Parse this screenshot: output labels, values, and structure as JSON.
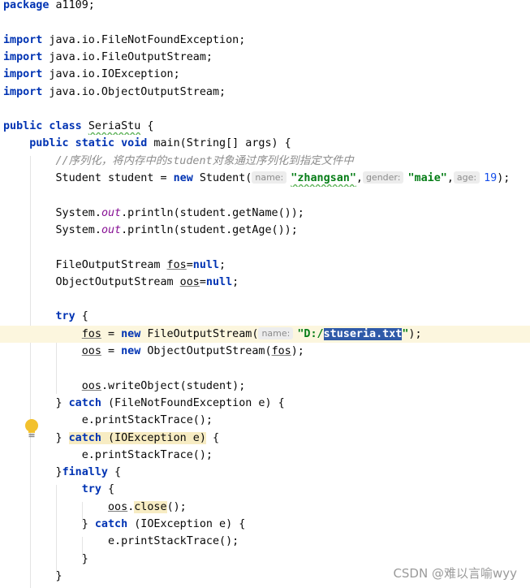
{
  "editor": {
    "language": "Java",
    "lines": [
      {
        "i": 0,
        "current": false,
        "segs": [
          {
            "c": "kw",
            "t": "package"
          },
          {
            "c": "",
            "t": " a1109;"
          }
        ]
      },
      {
        "i": 2,
        "current": false,
        "segs": [
          {
            "c": "kw",
            "t": "import"
          },
          {
            "c": "",
            "t": " java.io.FileNotFoundException;"
          }
        ]
      },
      {
        "i": 3,
        "current": false,
        "segs": [
          {
            "c": "kw",
            "t": "import"
          },
          {
            "c": "",
            "t": " java.io.FileOutputStream;"
          }
        ]
      },
      {
        "i": 4,
        "current": false,
        "segs": [
          {
            "c": "kw",
            "t": "import"
          },
          {
            "c": "",
            "t": " java.io.IOException;"
          }
        ]
      },
      {
        "i": 5,
        "current": false,
        "segs": [
          {
            "c": "kw",
            "t": "import"
          },
          {
            "c": "",
            "t": " java.io.ObjectOutputStream;"
          }
        ]
      },
      {
        "i": 7,
        "current": false,
        "segs": [
          {
            "c": "kw",
            "t": "public class"
          },
          {
            "c": "",
            "t": " "
          },
          {
            "c": "wavy",
            "t": "SeriaStu"
          },
          {
            "c": "",
            "t": " {"
          }
        ]
      },
      {
        "i": 8,
        "current": false,
        "segs": [
          {
            "c": "",
            "t": "    "
          },
          {
            "c": "kw",
            "t": "public static void"
          },
          {
            "c": "",
            "t": " main(String[] args) {"
          }
        ]
      },
      {
        "i": 9,
        "current": false,
        "segs": [
          {
            "c": "",
            "t": "        "
          },
          {
            "c": "cmt",
            "t": "//序列化，将内存中的student对象通过序列化到指定文件中"
          }
        ]
      },
      {
        "i": 10,
        "current": false,
        "segs": [
          {
            "c": "",
            "t": "        Student student = "
          },
          {
            "c": "kw",
            "t": "new"
          },
          {
            "c": "",
            "t": " Student("
          },
          {
            "c": "hint",
            "t": "name:"
          },
          {
            "c": "str wavy",
            "t": "\"zhangsan\""
          },
          {
            "c": "",
            "t": ","
          },
          {
            "c": "hint",
            "t": "gender:"
          },
          {
            "c": "str",
            "t": "\"maie\""
          },
          {
            "c": "",
            "t": ","
          },
          {
            "c": "hint",
            "t": "age:"
          },
          {
            "c": "num",
            "t": "19"
          },
          {
            "c": "",
            "t": ");"
          }
        ]
      },
      {
        "i": 12,
        "current": false,
        "segs": [
          {
            "c": "",
            "t": "        System."
          },
          {
            "c": "fld",
            "t": "out"
          },
          {
            "c": "",
            "t": ".println(student.getName());"
          }
        ]
      },
      {
        "i": 13,
        "current": false,
        "segs": [
          {
            "c": "",
            "t": "        System."
          },
          {
            "c": "fld",
            "t": "out"
          },
          {
            "c": "",
            "t": ".println(student.getAge());"
          }
        ]
      },
      {
        "i": 15,
        "current": false,
        "segs": [
          {
            "c": "",
            "t": "        FileOutputStream "
          },
          {
            "c": "var",
            "t": "fos"
          },
          {
            "c": "",
            "t": "="
          },
          {
            "c": "kw",
            "t": "null"
          },
          {
            "c": "",
            "t": ";"
          }
        ]
      },
      {
        "i": 16,
        "current": false,
        "segs": [
          {
            "c": "",
            "t": "        ObjectOutputStream "
          },
          {
            "c": "var",
            "t": "oos"
          },
          {
            "c": "",
            "t": "="
          },
          {
            "c": "kw",
            "t": "null"
          },
          {
            "c": "",
            "t": ";"
          }
        ]
      },
      {
        "i": 18,
        "current": false,
        "segs": [
          {
            "c": "",
            "t": "        "
          },
          {
            "c": "kw",
            "t": "try"
          },
          {
            "c": "",
            "t": " {"
          }
        ]
      },
      {
        "i": 19,
        "current": true,
        "segs": [
          {
            "c": "",
            "t": "            "
          },
          {
            "c": "var",
            "t": "fos"
          },
          {
            "c": "",
            "t": " = "
          },
          {
            "c": "kw",
            "t": "new"
          },
          {
            "c": "",
            "t": " FileOutputStream("
          },
          {
            "c": "hint",
            "t": "name:"
          },
          {
            "c": "str",
            "t": "\"D:/"
          },
          {
            "c": "str sel",
            "t": "stuseria.txt"
          },
          {
            "c": "str",
            "t": "\""
          },
          {
            "c": "",
            "t": ");"
          }
        ]
      },
      {
        "i": 20,
        "current": false,
        "segs": [
          {
            "c": "",
            "t": "            "
          },
          {
            "c": "var",
            "t": "oos"
          },
          {
            "c": "",
            "t": " = "
          },
          {
            "c": "kw",
            "t": "new"
          },
          {
            "c": "",
            "t": " ObjectOutputStream("
          },
          {
            "c": "var",
            "t": "fos"
          },
          {
            "c": "",
            "t": ");"
          }
        ]
      },
      {
        "i": 22,
        "current": false,
        "segs": [
          {
            "c": "",
            "t": "            "
          },
          {
            "c": "var",
            "t": "oos"
          },
          {
            "c": "",
            "t": ".writeObject(student);"
          }
        ]
      },
      {
        "i": 23,
        "current": false,
        "segs": [
          {
            "c": "",
            "t": "        } "
          },
          {
            "c": "kw",
            "t": "catch"
          },
          {
            "c": "",
            "t": " (FileNotFoundException e) {"
          }
        ]
      },
      {
        "i": 24,
        "current": false,
        "segs": [
          {
            "c": "",
            "t": "            e.printStackTrace();"
          }
        ]
      },
      {
        "i": 25,
        "current": false,
        "segs": [
          {
            "c": "",
            "t": "        } "
          },
          {
            "c": "kw hl",
            "t": "catch"
          },
          {
            "c": "hl",
            "t": " (IOException e)"
          },
          {
            "c": "",
            "t": " {"
          }
        ]
      },
      {
        "i": 26,
        "current": false,
        "segs": [
          {
            "c": "",
            "t": "            e.printStackTrace();"
          }
        ]
      },
      {
        "i": 27,
        "current": false,
        "segs": [
          {
            "c": "",
            "t": "        }"
          },
          {
            "c": "kw",
            "t": "finally"
          },
          {
            "c": "",
            "t": " {"
          }
        ]
      },
      {
        "i": 28,
        "current": false,
        "segs": [
          {
            "c": "",
            "t": "            "
          },
          {
            "c": "kw",
            "t": "try"
          },
          {
            "c": "",
            "t": " {"
          }
        ]
      },
      {
        "i": 29,
        "current": false,
        "segs": [
          {
            "c": "",
            "t": "                "
          },
          {
            "c": "var",
            "t": "oos"
          },
          {
            "c": "",
            "t": "."
          },
          {
            "c": "hl",
            "t": "close"
          },
          {
            "c": "",
            "t": "();"
          }
        ]
      },
      {
        "i": 30,
        "current": false,
        "segs": [
          {
            "c": "",
            "t": "            } "
          },
          {
            "c": "kw",
            "t": "catch"
          },
          {
            "c": "",
            "t": " (IOException e) {"
          }
        ]
      },
      {
        "i": 31,
        "current": false,
        "segs": [
          {
            "c": "",
            "t": "                e.printStackTrace();"
          }
        ]
      },
      {
        "i": 32,
        "current": false,
        "segs": [
          {
            "c": "",
            "t": "            }"
          }
        ]
      },
      {
        "i": 33,
        "current": false,
        "segs": [
          {
            "c": "",
            "t": "        }"
          }
        ]
      }
    ]
  },
  "gutter": {
    "intention_icon": "lightbulb-icon"
  },
  "watermark": "CSDN @难以言喻wyy",
  "colors": {
    "keyword": "#0033b3",
    "string": "#067d17",
    "number": "#1750eb",
    "comment": "#8c8c8c",
    "static_field": "#871094",
    "selection": "#2f5aa8",
    "current_line": "#fcf6de"
  }
}
